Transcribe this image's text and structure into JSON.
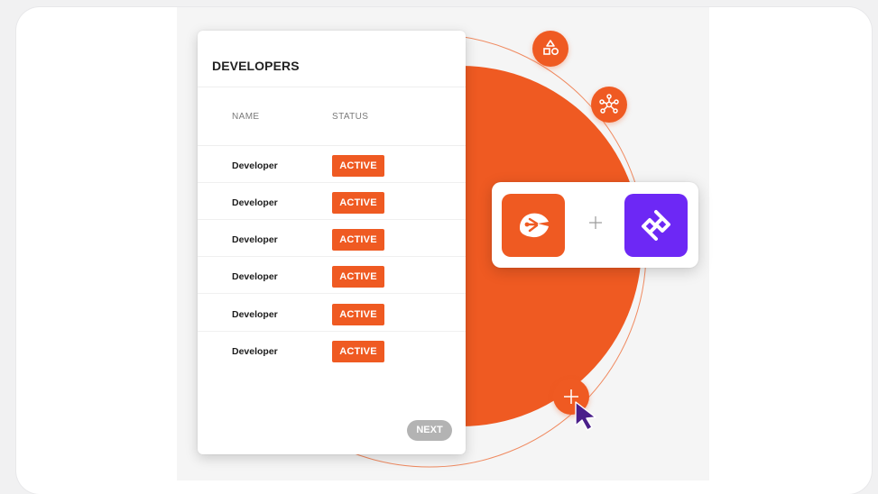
{
  "theme": {
    "accent": "#ef5a22",
    "partner_accent": "#6d28f5",
    "muted_button": "#b3b3b3"
  },
  "developers_table": {
    "title": "DEVELOPERS",
    "columns": [
      "NAME",
      "STATUS"
    ],
    "rows": [
      {
        "name": "Developer",
        "status": "ACTIVE"
      },
      {
        "name": "Developer",
        "status": "ACTIVE"
      },
      {
        "name": "Developer",
        "status": "ACTIVE"
      },
      {
        "name": "Developer",
        "status": "ACTIVE"
      },
      {
        "name": "Developer",
        "status": "ACTIVE"
      },
      {
        "name": "Developer",
        "status": "ACTIVE"
      }
    ],
    "next_label": "NEXT"
  },
  "orbit_icons": [
    "shapes-icon",
    "network-nodes-icon",
    "plus-icon"
  ],
  "integration": {
    "left_app_icon": "orange-claw-logo-icon",
    "connector": "+",
    "right_app_icon": "purple-diamond-logo-icon"
  },
  "pointer": "mouse-cursor-icon"
}
